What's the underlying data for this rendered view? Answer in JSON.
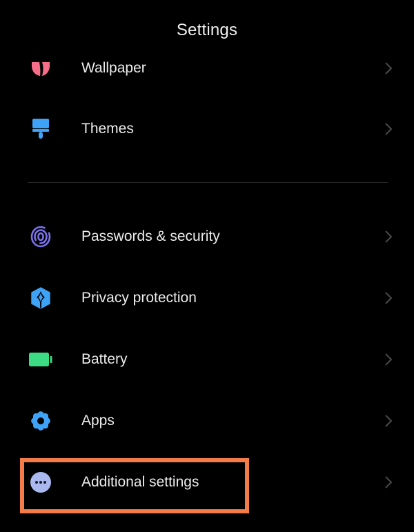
{
  "header": {
    "title": "Settings"
  },
  "items": [
    {
      "id": "wallpaper",
      "label": "Wallpaper",
      "icon": "wallpaper-icon",
      "icon_color": "#f66e8a"
    },
    {
      "id": "themes",
      "label": "Themes",
      "icon": "paintbrush-icon",
      "icon_color": "#3ea2f6"
    },
    {
      "id": "passwords-security",
      "label": "Passwords & security",
      "icon": "fingerprint-icon",
      "icon_color": "#7b74ec"
    },
    {
      "id": "privacy-protection",
      "label": "Privacy protection",
      "icon": "privacy-shield-icon",
      "icon_color": "#3ea2f6"
    },
    {
      "id": "battery",
      "label": "Battery",
      "icon": "battery-icon",
      "icon_color": "#3ddc84"
    },
    {
      "id": "apps",
      "label": "Apps",
      "icon": "gear-icon",
      "icon_color": "#3ea2f6"
    },
    {
      "id": "additional-settings",
      "label": "Additional settings",
      "icon": "more-dots-icon",
      "icon_color": "#a9b9ef"
    }
  ],
  "highlight": {
    "target": "additional-settings",
    "color": "#f47c48"
  }
}
